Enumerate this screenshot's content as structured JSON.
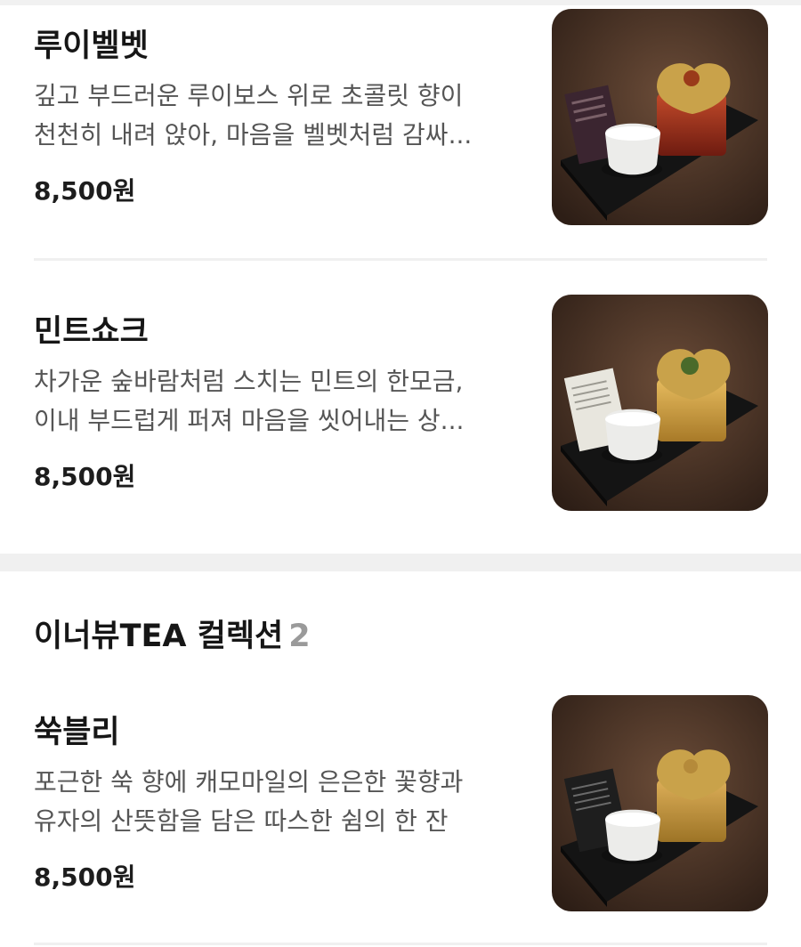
{
  "menu_items": [
    {
      "name": "루이벨벳",
      "desc_lines": [
        "깊고 부드러운 루이보스 위로 초콜릿 향이",
        "천천히 내려 앉아, 마음을 벨벳처럼 감싸..."
      ],
      "price": "8,500원",
      "photo": "tea-set-red-tea-photo",
      "tea_color": "#9a2a1a"
    },
    {
      "name": "민트쇼크",
      "desc_lines": [
        "차가운 숲바람처럼 스치는 민트의 한모금,",
        "이내 부드럽게 퍼져 마음을 씻어내는 상..."
      ],
      "price": "8,500원",
      "photo": "tea-set-mint-tea-photo",
      "tea_color": "#d9a646"
    },
    {
      "name": "쑥블리",
      "desc_lines": [
        "포근한 쑥 향에 캐모마일의 은은한 꽃향과",
        "유자의 산뜻함을 담은 따스한 쉼의 한 잔"
      ],
      "price": "8,500원",
      "photo": "tea-set-mugwort-tea-photo",
      "tea_color": "#cf9e4a"
    }
  ],
  "section": {
    "title": "이너뷰TEA 컬렉션",
    "count": "2"
  },
  "colors": {
    "text": "#161616",
    "description": "#555555",
    "divider": "#f0f0f0",
    "count": "#9a9a9a",
    "photo_background": "#4a3427"
  }
}
